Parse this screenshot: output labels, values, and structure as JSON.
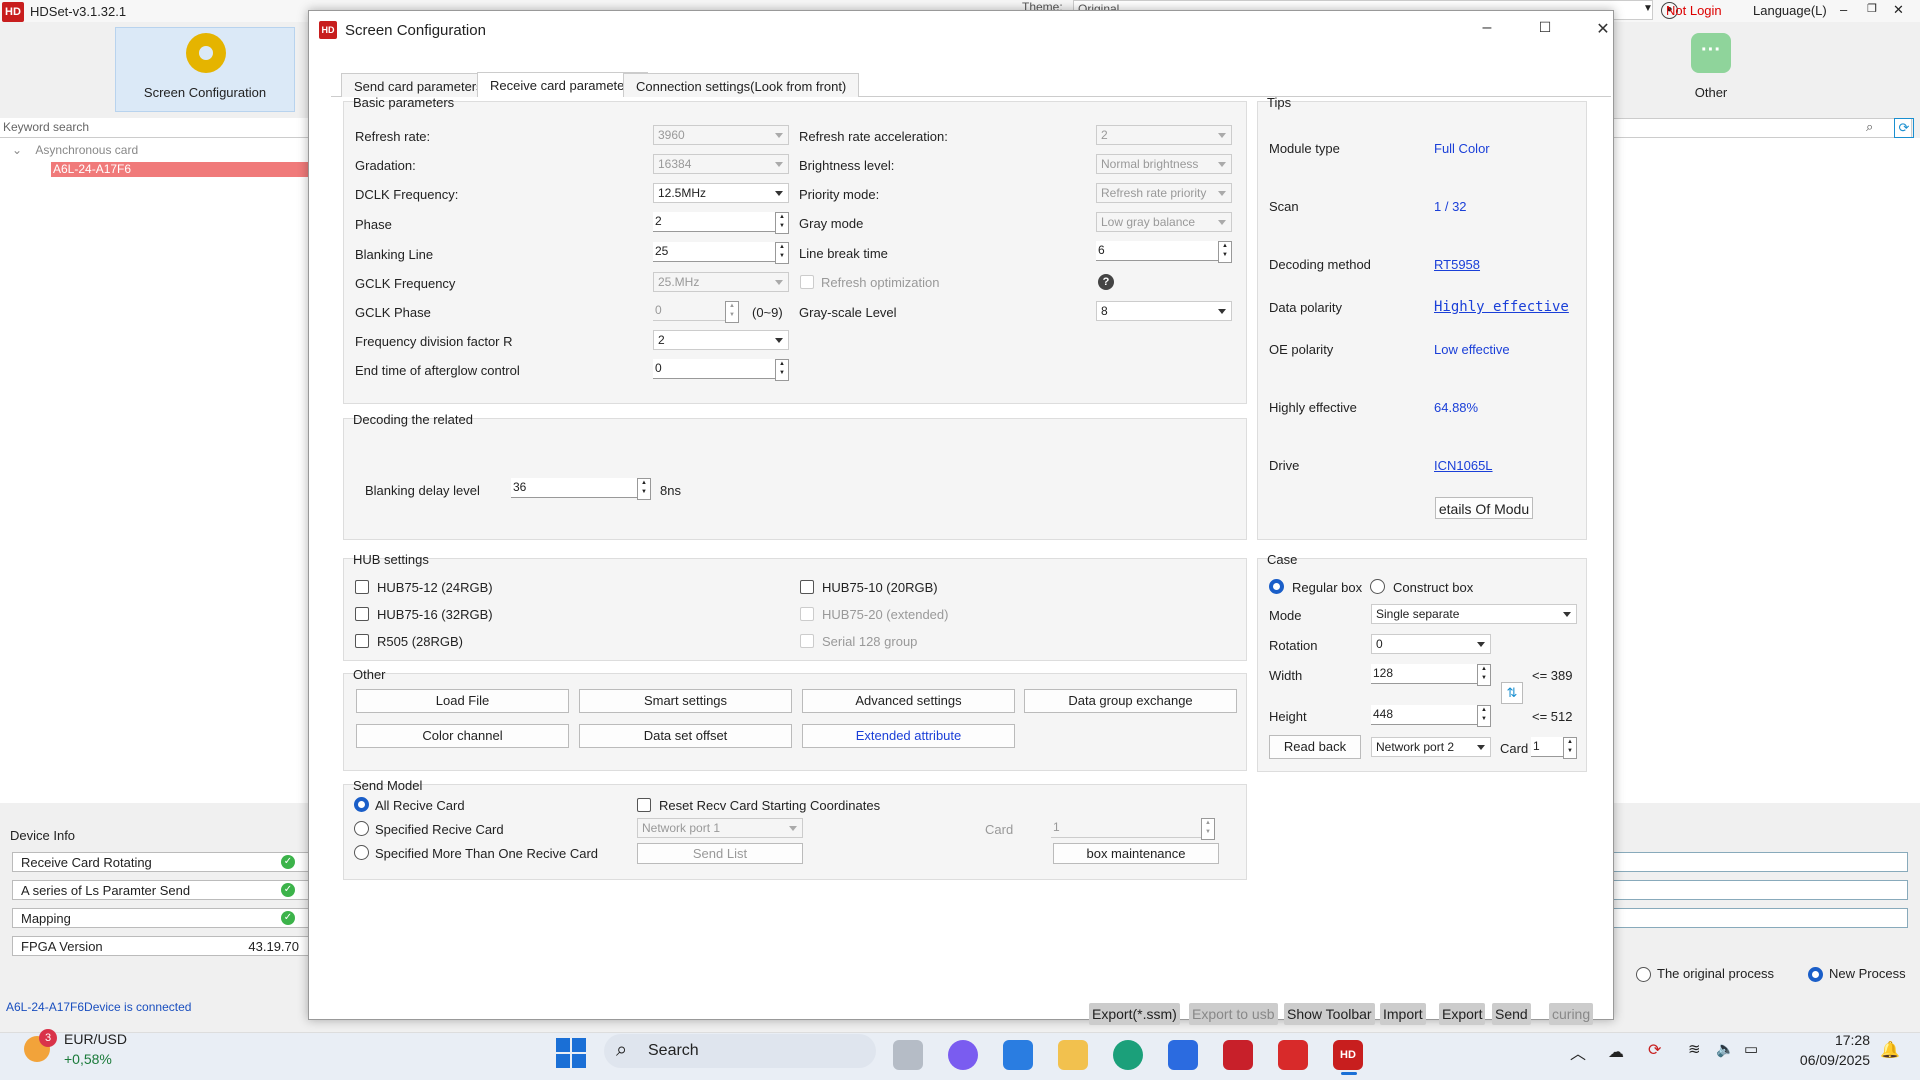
{
  "app": {
    "title": "HDSet-v3.1.32.1",
    "logo": "HD",
    "theme_label": "Theme:",
    "theme_value": "Original",
    "login": "Not Login",
    "language": "Language(L)"
  },
  "toolbar": {
    "screen_config": "Screen Configuration",
    "other": "Other"
  },
  "left": {
    "keyword_placeholder": "Keyword search",
    "tree_root": "Asynchronous card",
    "tree_item": "A6L-24-A17F6"
  },
  "device_info": {
    "title": "Device Info",
    "rows": [
      {
        "label": "Receive Card Rotating",
        "value": "✓"
      },
      {
        "label": "A series of Ls Paramter Send",
        "value": "✓"
      },
      {
        "label": "Mapping",
        "value": "✓"
      },
      {
        "label": "FPGA Version",
        "value": "43.19.70"
      }
    ],
    "status": "A6L-24-A17F6Device is connected"
  },
  "process": {
    "original": "The original process",
    "new": "New Process"
  },
  "dialog": {
    "title": "Screen Configuration",
    "tabs": [
      "Send card parameters",
      "Receive card parameters",
      "Connection settings(Look from front)"
    ],
    "basic": {
      "title": "Basic parameters",
      "refresh_rate": {
        "label": "Refresh rate:",
        "value": "3960"
      },
      "gradation": {
        "label": "Gradation:",
        "value": "16384"
      },
      "dclk": {
        "label": "DCLK Frequency:",
        "value": "12.5MHz"
      },
      "phase": {
        "label": "Phase",
        "value": "2"
      },
      "blanking_line": {
        "label": "Blanking Line",
        "value": "25"
      },
      "gclk_freq": {
        "label": "GCLK Frequency",
        "value": "25.MHz"
      },
      "gclk_phase": {
        "label": "GCLK Phase",
        "value": "0",
        "range": "(0~9)"
      },
      "freq_div": {
        "label": "Frequency division factor R",
        "value": "2"
      },
      "afterglow": {
        "label": "End time of afterglow control",
        "value": "0"
      },
      "rr_accel": {
        "label": "Refresh rate acceleration:",
        "value": "2"
      },
      "brightness": {
        "label": "Brightness level:",
        "value": "Normal brightness"
      },
      "priority": {
        "label": "Priority mode:",
        "value": "Refresh rate priority"
      },
      "gray_mode": {
        "label": "Gray mode",
        "value": "Low gray balance"
      },
      "line_break": {
        "label": "Line break time",
        "value": "6"
      },
      "refresh_opt": "Refresh optimization",
      "help": "?",
      "gray_level": {
        "label": "Gray-scale Level",
        "value": "8"
      }
    },
    "decoding": {
      "title": "Decoding the related",
      "blank_delay_label": "Blanking delay level",
      "blank_delay_value": "36",
      "unit": "8ns"
    },
    "tips": {
      "title": "Tips",
      "rows": [
        {
          "label": "Module type",
          "value": "Full Color"
        },
        {
          "label": "Scan",
          "value": "1 / 32"
        },
        {
          "label": "Decoding method",
          "value": "RT5958"
        },
        {
          "label": "Data polarity",
          "value": "Highly effective"
        },
        {
          "label": "OE polarity",
          "value": "Low effective"
        },
        {
          "label": "Highly effective",
          "value": "64.88%"
        },
        {
          "label": "Drive",
          "value": "ICN1065L"
        }
      ],
      "details_btn": "etails Of Modu"
    },
    "hub": {
      "title": "HUB settings",
      "items": [
        "HUB75-12 (24RGB)",
        "HUB75-16 (32RGB)",
        "R505 (28RGB)",
        "HUB75-10 (20RGB)",
        "HUB75-20 (extended)",
        "Serial 128 group"
      ]
    },
    "case": {
      "title": "Case",
      "regular": "Regular box",
      "construct": "Construct box",
      "mode_label": "Mode",
      "mode_value": "Single separate",
      "rotation_label": "Rotation",
      "rotation_value": "0",
      "width_label": "Width",
      "width_value": "128",
      "width_max": "<= 389",
      "height_label": "Height",
      "height_value": "448",
      "height_max": "<= 512",
      "read_back": "Read back",
      "port_value": "Network port 2",
      "card_label": "Card",
      "card_value": "1"
    },
    "other": {
      "title": "Other",
      "buttons": [
        "Load File",
        "Smart settings",
        "Advanced settings",
        "Data group exchange",
        "Color channel",
        "Data set offset",
        "Extended attribute"
      ]
    },
    "send_model": {
      "title": "Send Model",
      "all": "All Recive Card",
      "specified": "Specified Recive Card",
      "multiple": "Specified More Than One Recive Card",
      "reset": "Reset Recv Card Starting Coordinates",
      "port": "Network port 1",
      "send_list": "Send List",
      "card_label": "Card",
      "card_value": "1",
      "box_maint": "box maintenance"
    },
    "footer": [
      "Export(*.ssm)",
      "Export to usb",
      "Show Toolbar",
      "Import",
      "Export",
      "Send",
      "curing"
    ]
  },
  "taskbar": {
    "ticker": "EUR/USD",
    "change": "+0,58%",
    "badge": "3",
    "search": "Search",
    "time": "17:28",
    "date": "06/09/2025"
  }
}
